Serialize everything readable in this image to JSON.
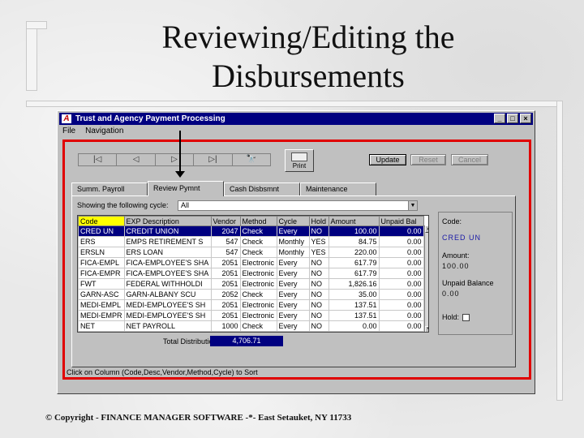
{
  "slide": {
    "title_line1": "Reviewing/Editing the",
    "title_line2": "Disbursements",
    "copyright": "© Copyright - FINANCE MANAGER SOFTWARE -*- East Setauket, NY 11733"
  },
  "window": {
    "title": "Trust and Agency Payment Processing",
    "app_icon_letter": "A",
    "controls": {
      "minimize": "_",
      "maximize": "□",
      "close": "×"
    },
    "menu": [
      "File",
      "Navigation"
    ]
  },
  "toolbar": {
    "nav": {
      "first": "|◁",
      "prev": "◁",
      "next": "▷",
      "last": "▷|",
      "find": "🔭"
    },
    "print_label": "Print",
    "update_label": "Update",
    "reset_label": "Reset",
    "cancel_label": "Cancel"
  },
  "tabs": [
    "Summ. Payroll",
    "Review Pymnt",
    "Cash Disbsmnt",
    "Maintenance"
  ],
  "cycle": {
    "label": "Showing the following cycle:",
    "value": "All"
  },
  "grid": {
    "columns": [
      "Code",
      "EXP Description",
      "Vendor",
      "Method",
      "Cycle",
      "Hold",
      "Amount",
      "Unpaid Bal"
    ],
    "rows": [
      [
        "CRED UN",
        "CREDIT UNION",
        "2047",
        "Check",
        "Every",
        "NO",
        "100.00",
        "0.00"
      ],
      [
        "ERS",
        "EMPS RETIREMENT S",
        "547",
        "Check",
        "Monthly",
        "YES",
        "84.75",
        "0.00"
      ],
      [
        "ERSLN",
        "ERS LOAN",
        "547",
        "Check",
        "Monthly",
        "YES",
        "220.00",
        "0.00"
      ],
      [
        "FICA-EMPL",
        "FICA-EMPLOYEE'S SHA",
        "2051",
        "Electronic",
        "Every",
        "NO",
        "617.79",
        "0.00"
      ],
      [
        "FICA-EMPR",
        "FICA-EMPLOYEE'S SHA",
        "2051",
        "Electronic",
        "Every",
        "NO",
        "617.79",
        "0.00"
      ],
      [
        "FWT",
        "FEDERAL WITHHOLDI",
        "2051",
        "Electronic",
        "Every",
        "NO",
        "1,826.16",
        "0.00"
      ],
      [
        "GARN-ASC",
        "GARN-ALBANY SCU",
        "2052",
        "Check",
        "Every",
        "NO",
        "35.00",
        "0.00"
      ],
      [
        "MEDI-EMPL",
        "MEDI-EMPLOYEE'S SH",
        "2051",
        "Electronic",
        "Every",
        "NO",
        "137.51",
        "0.00"
      ],
      [
        "MEDI-EMPR",
        "MEDI-EMPLOYEE'S SH",
        "2051",
        "Electronic",
        "Every",
        "NO",
        "137.51",
        "0.00"
      ],
      [
        "NET",
        "NET PAYROLL",
        "1000",
        "Check",
        "Every",
        "NO",
        "0.00",
        "0.00"
      ]
    ]
  },
  "detail": {
    "code_label": "Code:",
    "code_value": "CRED UN",
    "amount_label": "Amount:",
    "amount_value": "100.00",
    "unpaid_label": "Unpaid Balance",
    "unpaid_value": "0.00",
    "hold_label": "Hold:"
  },
  "total": {
    "label": "Total Distribution",
    "value": "4,706.71"
  },
  "status_text": "Click on Column (Code,Desc,Vendor,Method,Cycle) to Sort"
}
